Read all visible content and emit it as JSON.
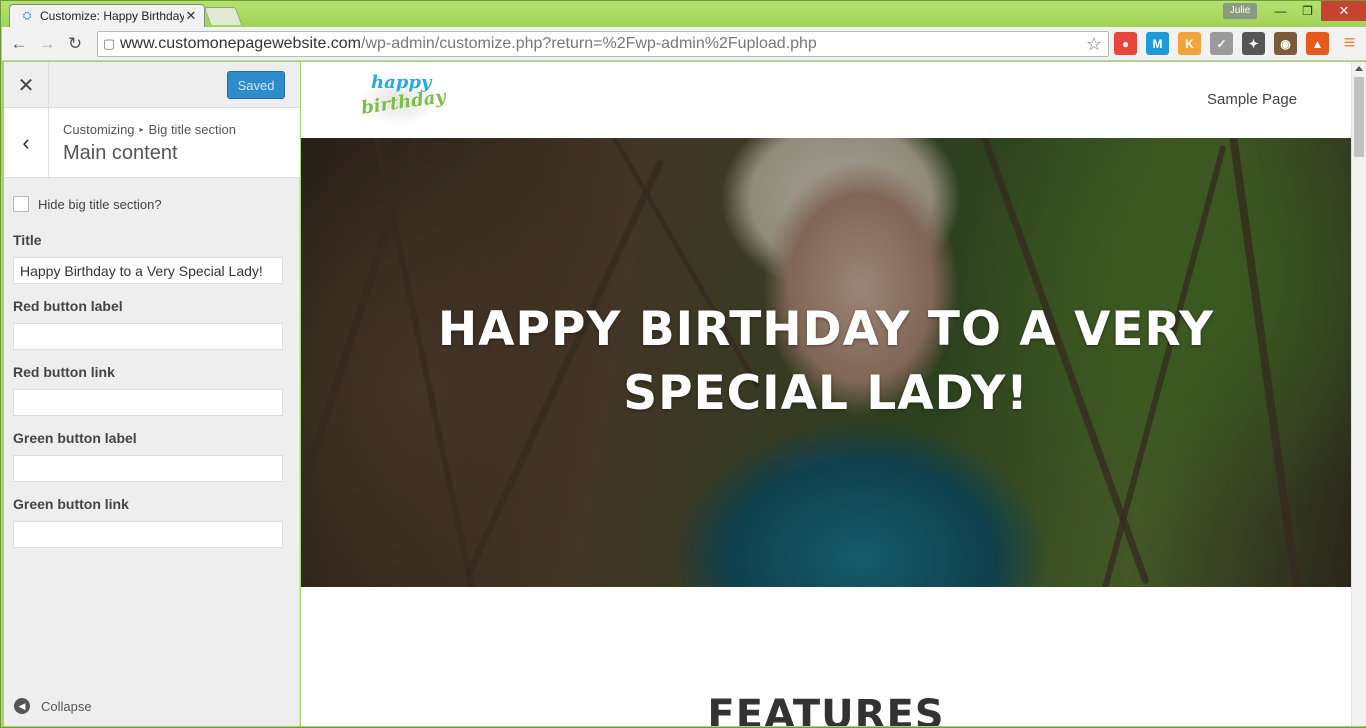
{
  "browser": {
    "tab_title": "Customize: Happy Birthday",
    "tab_close_glyph": "✕",
    "user_chip": "Julie",
    "window_buttons": {
      "minimize": "—",
      "restore": "❐",
      "close": "✕"
    },
    "nav": {
      "back": "←",
      "forward": "→",
      "reload": "↻"
    },
    "url_domain": "www.customonepagewebsite.com",
    "url_path": "/wp-admin/customize.php?return=%2Fwp-admin%2Fupload.php",
    "bookmark_star": "☆",
    "extensions": [
      {
        "icon": "color-wheel-icon",
        "label": "●",
        "color": "#e8453c"
      },
      {
        "icon": "m-extension-icon",
        "label": "M",
        "color": "#1e9bd7"
      },
      {
        "icon": "k-extension-icon",
        "label": "K",
        "color": "#f2a33a"
      },
      {
        "icon": "check-extension-icon",
        "label": "✓",
        "color": "#9a9a9a"
      },
      {
        "icon": "puzzle-extension-icon",
        "label": "✦",
        "color": "#555555"
      },
      {
        "icon": "camera-extension-icon",
        "label": "◉",
        "color": "#7a5c3c"
      },
      {
        "icon": "fire-extension-icon",
        "label": "▲",
        "color": "#e85a1b"
      },
      {
        "icon": "menu-icon",
        "label": "≡",
        "color": "#e8872a"
      }
    ]
  },
  "sidebar": {
    "close_glyph": "✕",
    "saved_label": "Saved",
    "back_glyph": "‹",
    "breadcrumb_root": "Customizing",
    "breadcrumb_sep": "▸",
    "breadcrumb_section": "Big title section",
    "section_title": "Main content",
    "hide_label": "Hide big title section?",
    "fields": {
      "title_label": "Title",
      "title_value": "Happy Birthday to a Very Special Lady!",
      "red_label_label": "Red button label",
      "red_label_value": "",
      "red_link_label": "Red button link",
      "red_link_value": "",
      "green_label_label": "Green button label",
      "green_label_value": "",
      "green_link_label": "Green button link",
      "green_link_value": ""
    },
    "collapse_glyph": "◀",
    "collapse_label": "Collapse"
  },
  "preview": {
    "logo_line1": "happy",
    "logo_line2": "birthday",
    "nav_link": "Sample Page",
    "hero_title": "HAPPY BIRTHDAY TO A VERY SPECIAL LADY!",
    "features_heading": "FEATURES"
  }
}
